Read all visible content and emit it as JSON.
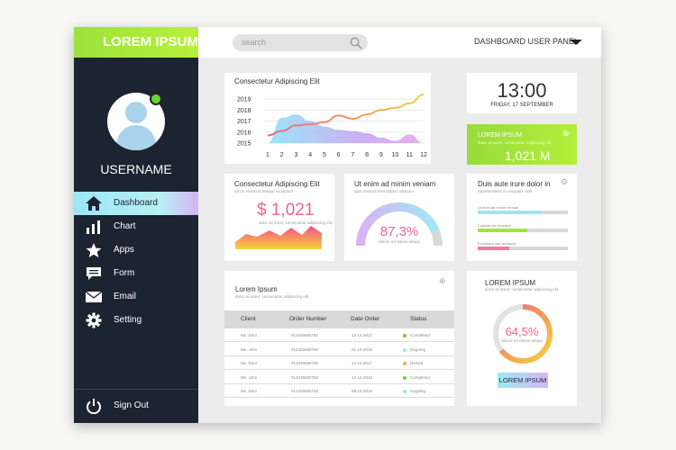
{
  "brand": "LOREM IPSUM",
  "user": {
    "name": "USERNAME"
  },
  "nav": {
    "items": [
      {
        "label": "Dashboard"
      },
      {
        "label": "Chart"
      },
      {
        "label": "Apps"
      },
      {
        "label": "Form"
      },
      {
        "label": "Email"
      },
      {
        "label": "Setting"
      }
    ],
    "active": "Dashboard",
    "signout": "Sign Out"
  },
  "topbar": {
    "search_placeholder": "search",
    "panel_title": "DASHBOARD USER PANEL"
  },
  "area_chart": {
    "title": "Consectetur Adipiscing Elit",
    "chart_data": {
      "type": "area",
      "title": "Consectetur Adipiscing Elit",
      "x": [
        1,
        2,
        3,
        4,
        5,
        6,
        7,
        8,
        9,
        10,
        11,
        12
      ],
      "y_ticks": [
        "2015",
        "2016",
        "2017",
        "2018",
        "2019"
      ],
      "ylim": [
        2015,
        2019
      ],
      "series": [
        {
          "type": "line",
          "values": [
            2015.7,
            2016.1,
            2016.6,
            2016.7,
            2016.9,
            2017.5,
            2017.2,
            2017.6,
            2018.0,
            2018.2,
            2018.6,
            2019.4
          ]
        },
        {
          "type": "area",
          "values": [
            2015,
            2017.3,
            2017.6,
            2017.0,
            2016.5,
            2016.2,
            2016.1,
            2015.9,
            2015.5,
            2015.2,
            2015.8,
            2015.0
          ]
        }
      ],
      "grid": true
    }
  },
  "clock": {
    "time": "13:00",
    "date": "FRIDAY, 17 SEPTEMBER"
  },
  "stat_green": {
    "title": "LOREM IPSUM",
    "subtitle": "dolor sit amet, consectetur adipiscing elit,",
    "value": "1,021 M",
    "action": "⊕"
  },
  "stat_money": {
    "title": "Consectetur Adipiscing Elit",
    "subtitle": "ed do eiusmod tempor incididunt",
    "value": "$ 1,021",
    "caption": "dolor sit amet, consectetur adipiscing elit,"
  },
  "gauge": {
    "title": "Ut enim ad minim veniam",
    "subtitle": "quis nostrud exercitation ullamco",
    "value": "87,3%",
    "caption": "labore ed dolore aliqua",
    "percent": 87.3
  },
  "progress_card": {
    "title": "Duis aute irure dolor in",
    "subtitle": "reprehenderit in voluptate velit",
    "bars": [
      {
        "label": "Ut enim ad minim veniam",
        "value": 0.7,
        "color": "#9ee4f4"
      },
      {
        "label": "Cupidat non proident",
        "value": 0.55,
        "color": "#a6e23c"
      },
      {
        "label": "Excepteur sint occaecat",
        "value": 0.35,
        "color": "#f07aa0"
      }
    ]
  },
  "table_card": {
    "title": "Lorem Ipsum",
    "subtitle": "dolor sit amet, consectetur adipiscing elit,",
    "columns": [
      "Client",
      "Order Number",
      "Date Order",
      "Status"
    ],
    "rows": [
      {
        "client": "Ms. Doni",
        "order": "#12345690760",
        "date": "12-14-2017",
        "status": "Completed",
        "color": "#6cd42a"
      },
      {
        "client": "Ms. John",
        "order": "#12345690760",
        "date": "01-14-2019",
        "status": "Ongoing",
        "color": "#9ee4f4"
      },
      {
        "client": "Ms. Doni",
        "order": "#12345690760",
        "date": "12-14-2017",
        "status": "Denied",
        "color": "#f5b041"
      },
      {
        "client": "Ms. John",
        "order": "#12345690760",
        "date": "12-14-2018",
        "status": "Completed",
        "color": "#6cd42a"
      },
      {
        "client": "Ms. Doni",
        "order": "#12345690760",
        "date": "08-14-2019",
        "status": "Ongoing",
        "color": "#9ee4f4"
      }
    ]
  },
  "donut_card": {
    "title": "LOREM IPSUM",
    "subtitle": "dolor sit amet, consectetur adipiscing elit,",
    "value": "64,5%",
    "caption": "labore ed dolore aliqua",
    "percent": 64.5,
    "button": "LOREM IPSUM"
  },
  "icons": {
    "search": "search-icon",
    "home": "home-icon",
    "chart": "bar-chart-icon",
    "apps": "star-icon",
    "form": "chat-bubble-icon",
    "email": "envelope-icon",
    "setting": "gear-icon",
    "signout": "power-icon",
    "dropdown": "caret-down-icon"
  },
  "colors": {
    "sidebar": "#1c2431",
    "accent_green": "#9be23c",
    "accent_cyan": "#9ee4f4",
    "pink": "#f06292"
  }
}
